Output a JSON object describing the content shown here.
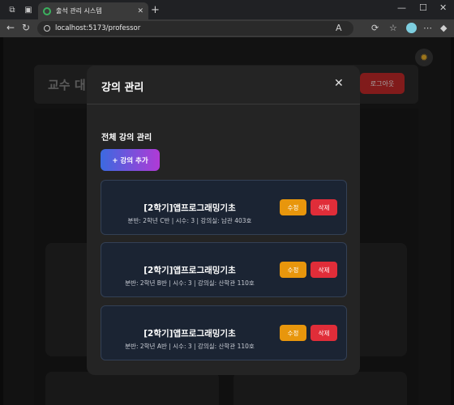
{
  "browser": {
    "tab_title": "출석 관리 시스템",
    "url": "localhost:5173/professor"
  },
  "page": {
    "header_title": "교수 대",
    "logout_label": "로그아웃"
  },
  "modal": {
    "title": "강의 관리",
    "section_title": "전체 강의 관리",
    "add_button": "+ 강의 추가",
    "courses": [
      {
        "title": "[2학기]앱프로그래밍기초",
        "details": "분반: 2학년 C반 | 시수: 3 | 강의실: 남관 403호",
        "edit": "수정",
        "delete": "삭제"
      },
      {
        "title": "[2학기]앱프로그래밍기초",
        "details": "분반: 2학년 B반 | 시수: 3 | 강의실: 산학관 110호",
        "edit": "수정",
        "delete": "삭제"
      },
      {
        "title": "[2학기]앱프로그래밍기초",
        "details": "분반: 2학년 A반 | 시수: 3 | 강의실: 산학관 110호",
        "edit": "수정",
        "delete": "삭제"
      }
    ]
  },
  "colors": {
    "edit": "#e8960c",
    "delete": "#e02d39",
    "logout": "#c72a2a",
    "course_card": "#1b2433"
  }
}
